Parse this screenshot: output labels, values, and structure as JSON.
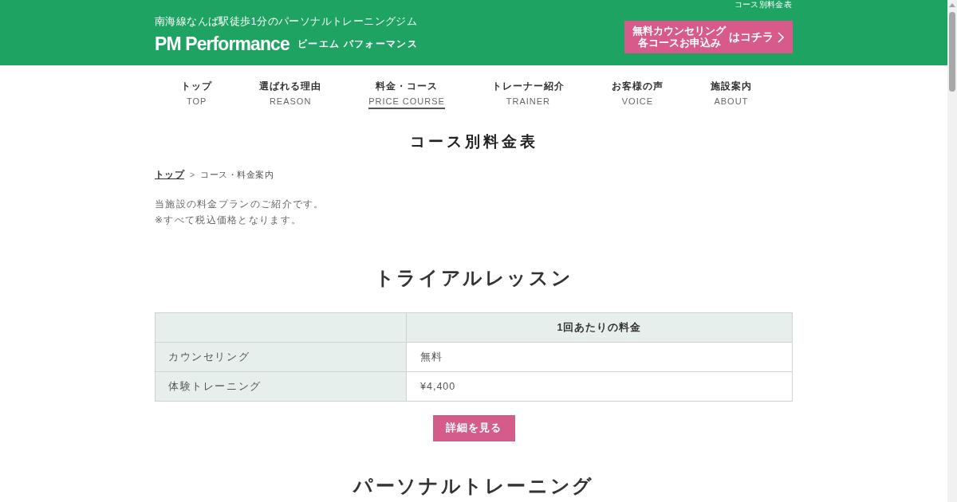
{
  "header": {
    "page_label": "コース別料金表",
    "tagline": "南海線なんば駅徒歩1分のパーソナルトレーニングジム",
    "logo": "PM Performance",
    "logo_kana": "ビーエム パフォーマンス",
    "cta": {
      "lines": [
        "無料カウンセリング",
        "各コースお申込み"
      ],
      "suffix": "はコチラ"
    }
  },
  "nav": [
    {
      "label": "トップ",
      "sublabel": "TOP",
      "selected": false
    },
    {
      "label": "選ばれる理由",
      "sublabel": "REASON",
      "selected": false
    },
    {
      "label": "料金・コース",
      "sublabel": "PRICE COURSE",
      "selected": true
    },
    {
      "label": "トレーナー紹介",
      "sublabel": "TRAINER",
      "selected": false
    },
    {
      "label": "お客様の声",
      "sublabel": "VOICE",
      "selected": false
    },
    {
      "label": "施設案内",
      "sublabel": "ABOUT",
      "selected": false
    }
  ],
  "page_title": "コース別料金表",
  "breadcrumb": {
    "separator": ">",
    "items": [
      {
        "label": "トップ",
        "kind": "link"
      },
      {
        "label": "コース・料金案内",
        "kind": "current"
      }
    ]
  },
  "intro": [
    "当施設の料金プランのご紹介です。",
    "※すべて税込価格となります。"
  ],
  "sections": [
    {
      "title": "トライアルレッスン",
      "table": {
        "header": "1回あたりの料金",
        "rows": [
          {
            "label": "カウンセリング",
            "price": "無料"
          },
          {
            "label": "体験トレーニング",
            "price": "¥4,400"
          }
        ]
      },
      "button": "詳細を見る"
    },
    {
      "title": "パーソナルトレーニング"
    }
  ]
}
